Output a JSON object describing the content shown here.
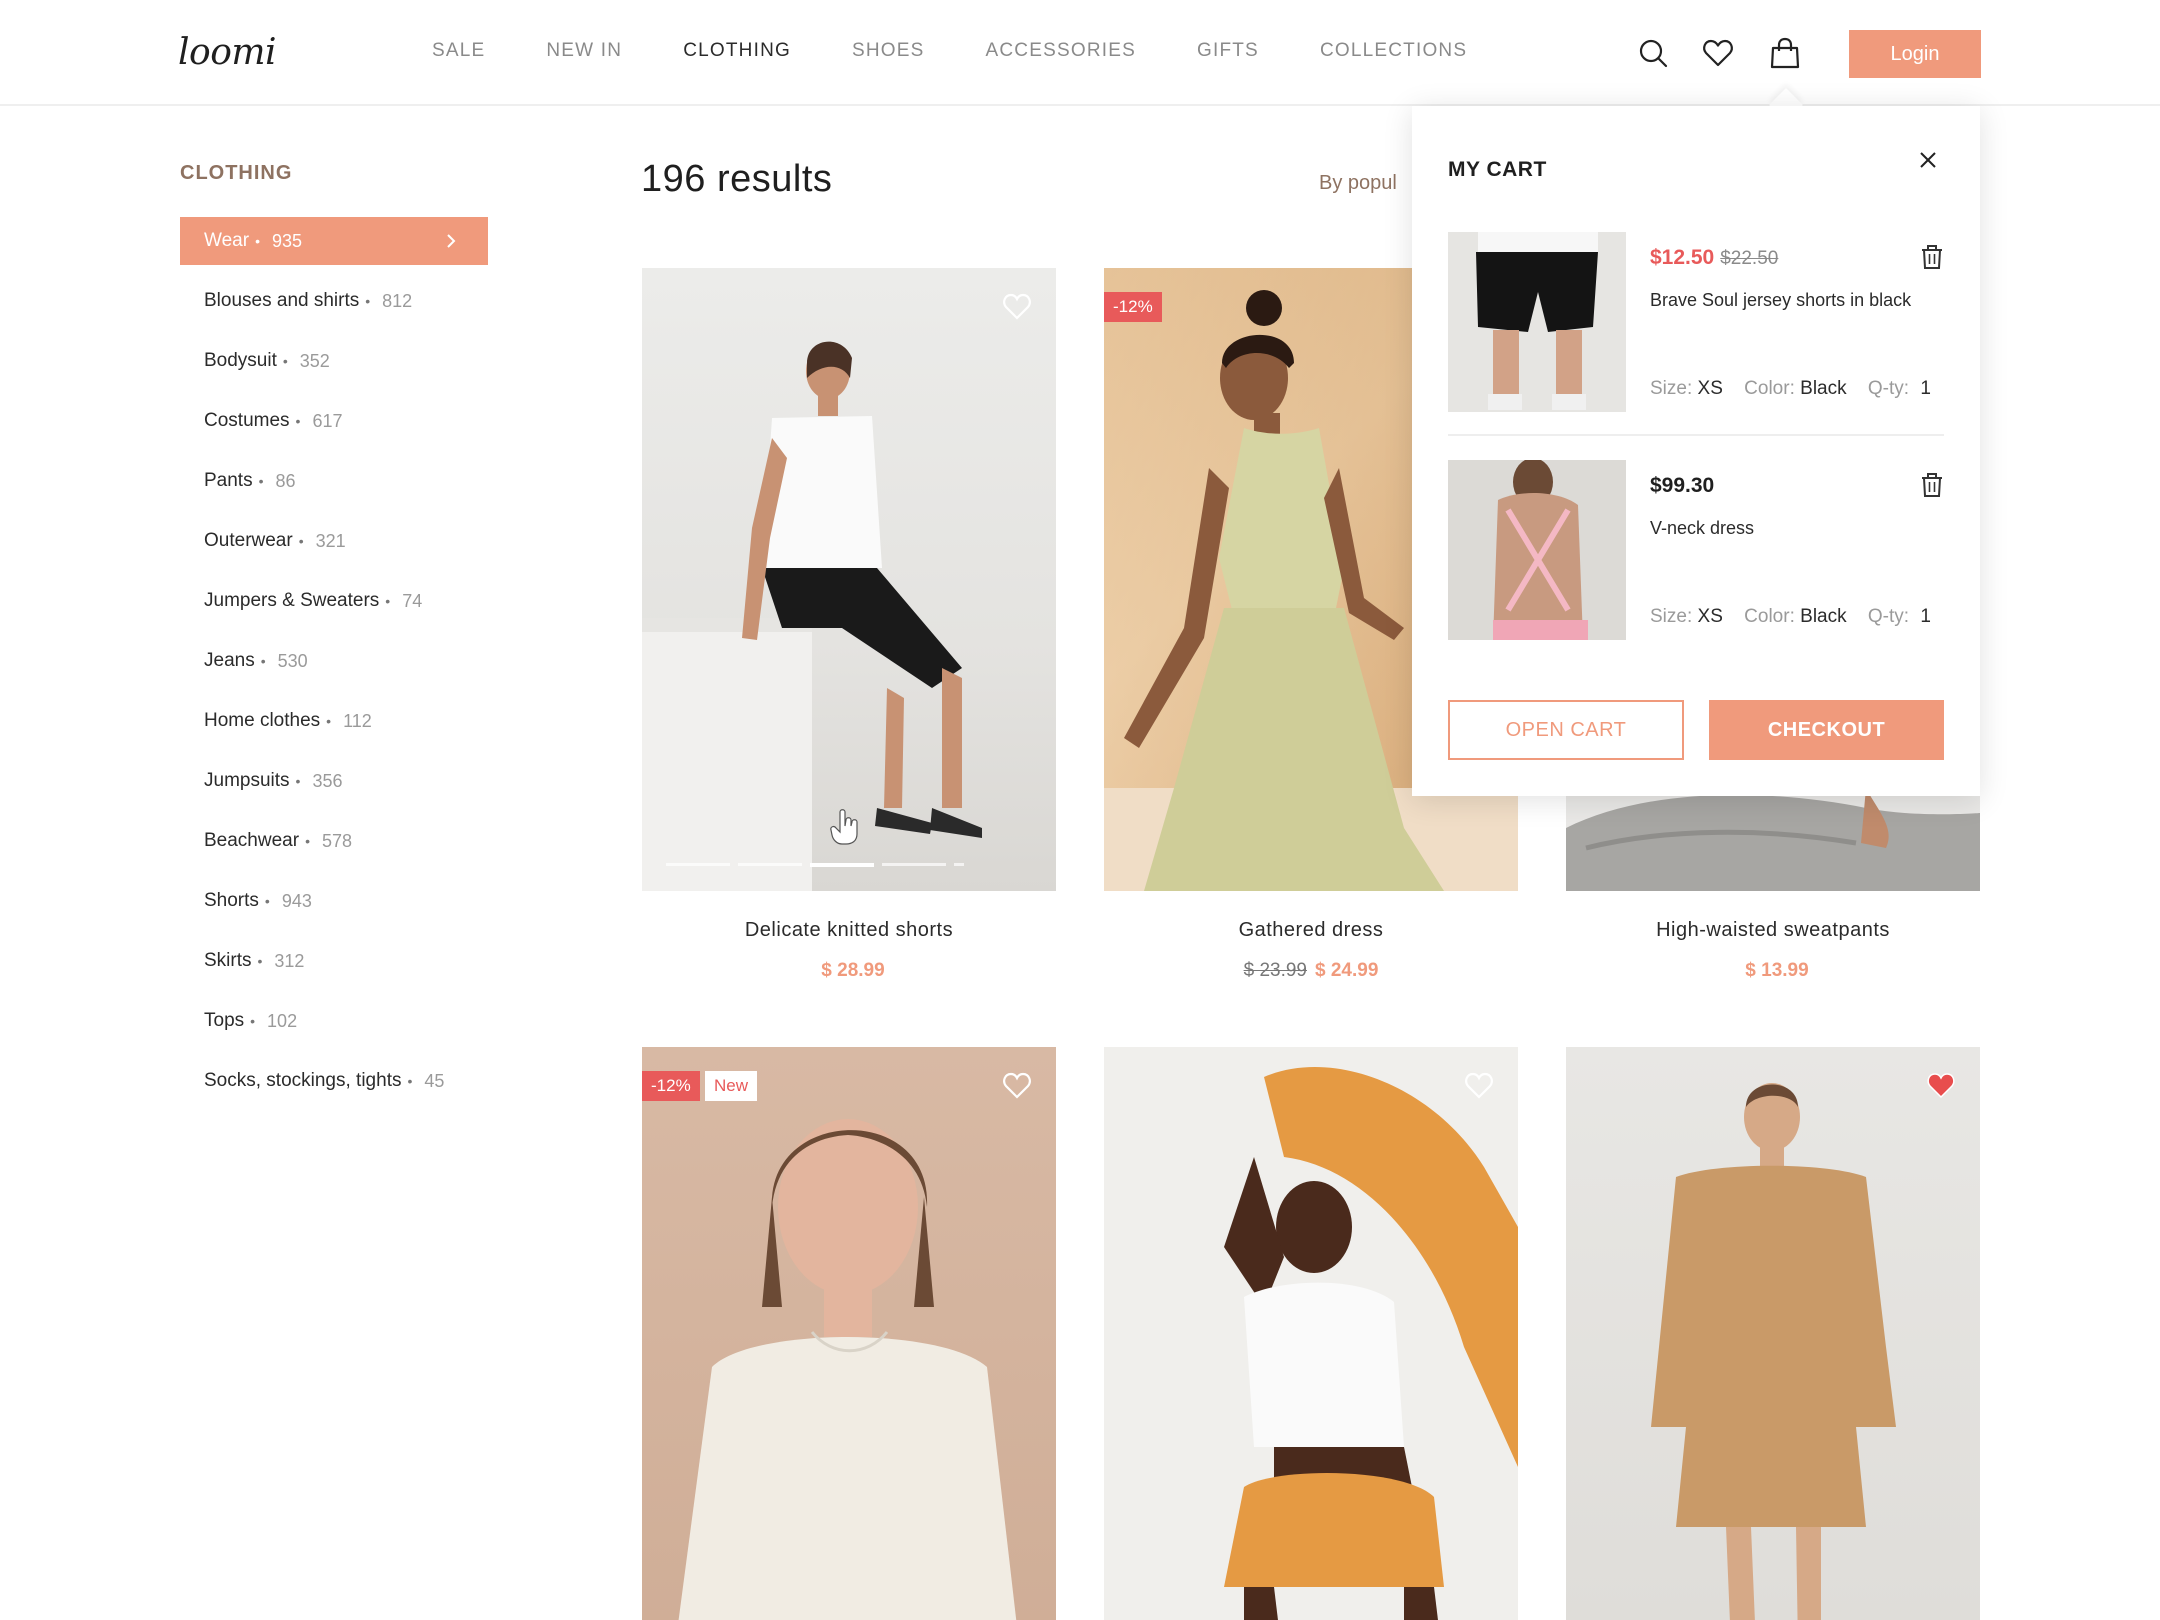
{
  "header": {
    "logo": "loomi",
    "nav": [
      "SALE",
      "NEW IN",
      "CLOTHING",
      "SHOES",
      "ACCESSORIES",
      "GIFTS",
      "COLLECTIONS"
    ],
    "active_nav": "CLOTHING",
    "login_label": "Login",
    "icons": [
      "search-icon",
      "heart-icon",
      "bag-icon"
    ]
  },
  "sidebar": {
    "title": "CLOTHING",
    "categories": [
      {
        "label": "Wear",
        "count": "935",
        "active": true
      },
      {
        "label": "Blouses and shirts",
        "count": "812"
      },
      {
        "label": "Bodysuit",
        "count": "352"
      },
      {
        "label": "Costumes",
        "count": "617"
      },
      {
        "label": "Pants",
        "count": "86"
      },
      {
        "label": "Outerwear",
        "count": "321"
      },
      {
        "label": "Jumpers & Sweaters",
        "count": "74"
      },
      {
        "label": "Jeans",
        "count": "530"
      },
      {
        "label": "Home clothes",
        "count": "112"
      },
      {
        "label": "Jumpsuits",
        "count": "356"
      },
      {
        "label": "Beachwear",
        "count": "578"
      },
      {
        "label": "Shorts",
        "count": "943"
      },
      {
        "label": "Skirts",
        "count": "312"
      },
      {
        "label": "Tops",
        "count": "102"
      },
      {
        "label": "Socks, stockings, tights",
        "count": "45"
      }
    ]
  },
  "main": {
    "results": "196 results",
    "sort_label": "By popul",
    "products": [
      {
        "title": "Delicate knitted shorts",
        "price": "$ 28.99",
        "old_price": "",
        "favorite": false
      },
      {
        "title": "Gathered dress",
        "price": "$ 24.99",
        "old_price": "$ 23.99",
        "badge": "-12%",
        "favorite": false
      },
      {
        "title": "High-waisted sweatpants",
        "price": "$ 13.99",
        "old_price": "",
        "favorite": false
      },
      {
        "title": "",
        "price": "",
        "badge": "-12%",
        "badge2": "New",
        "favorite": false
      },
      {
        "title": "",
        "price": "",
        "favorite": false
      },
      {
        "title": "",
        "price": "",
        "favorite": true
      }
    ]
  },
  "cart": {
    "title": "MY CART",
    "items": [
      {
        "price": "$12.50",
        "old_price": "$22.50",
        "name": "Brave Soul jersey shorts in black",
        "size_label": "Size:",
        "size": "XS",
        "color_label": "Color:",
        "color": "Black",
        "qty_label": "Q-ty:",
        "qty": "1"
      },
      {
        "price": "$99.30",
        "old_price": "",
        "name": "V-neck dress",
        "size_label": "Size:",
        "size": "XS",
        "color_label": "Color:",
        "color": "Black",
        "qty_label": "Q-ty:",
        "qty": "1"
      }
    ],
    "open_cart_label": "OPEN CART",
    "checkout_label": "CHECKOUT"
  },
  "colors": {
    "accent": "#f09a7c",
    "sale_red": "#e85a5a",
    "sidebar_title": "#8e7261"
  }
}
